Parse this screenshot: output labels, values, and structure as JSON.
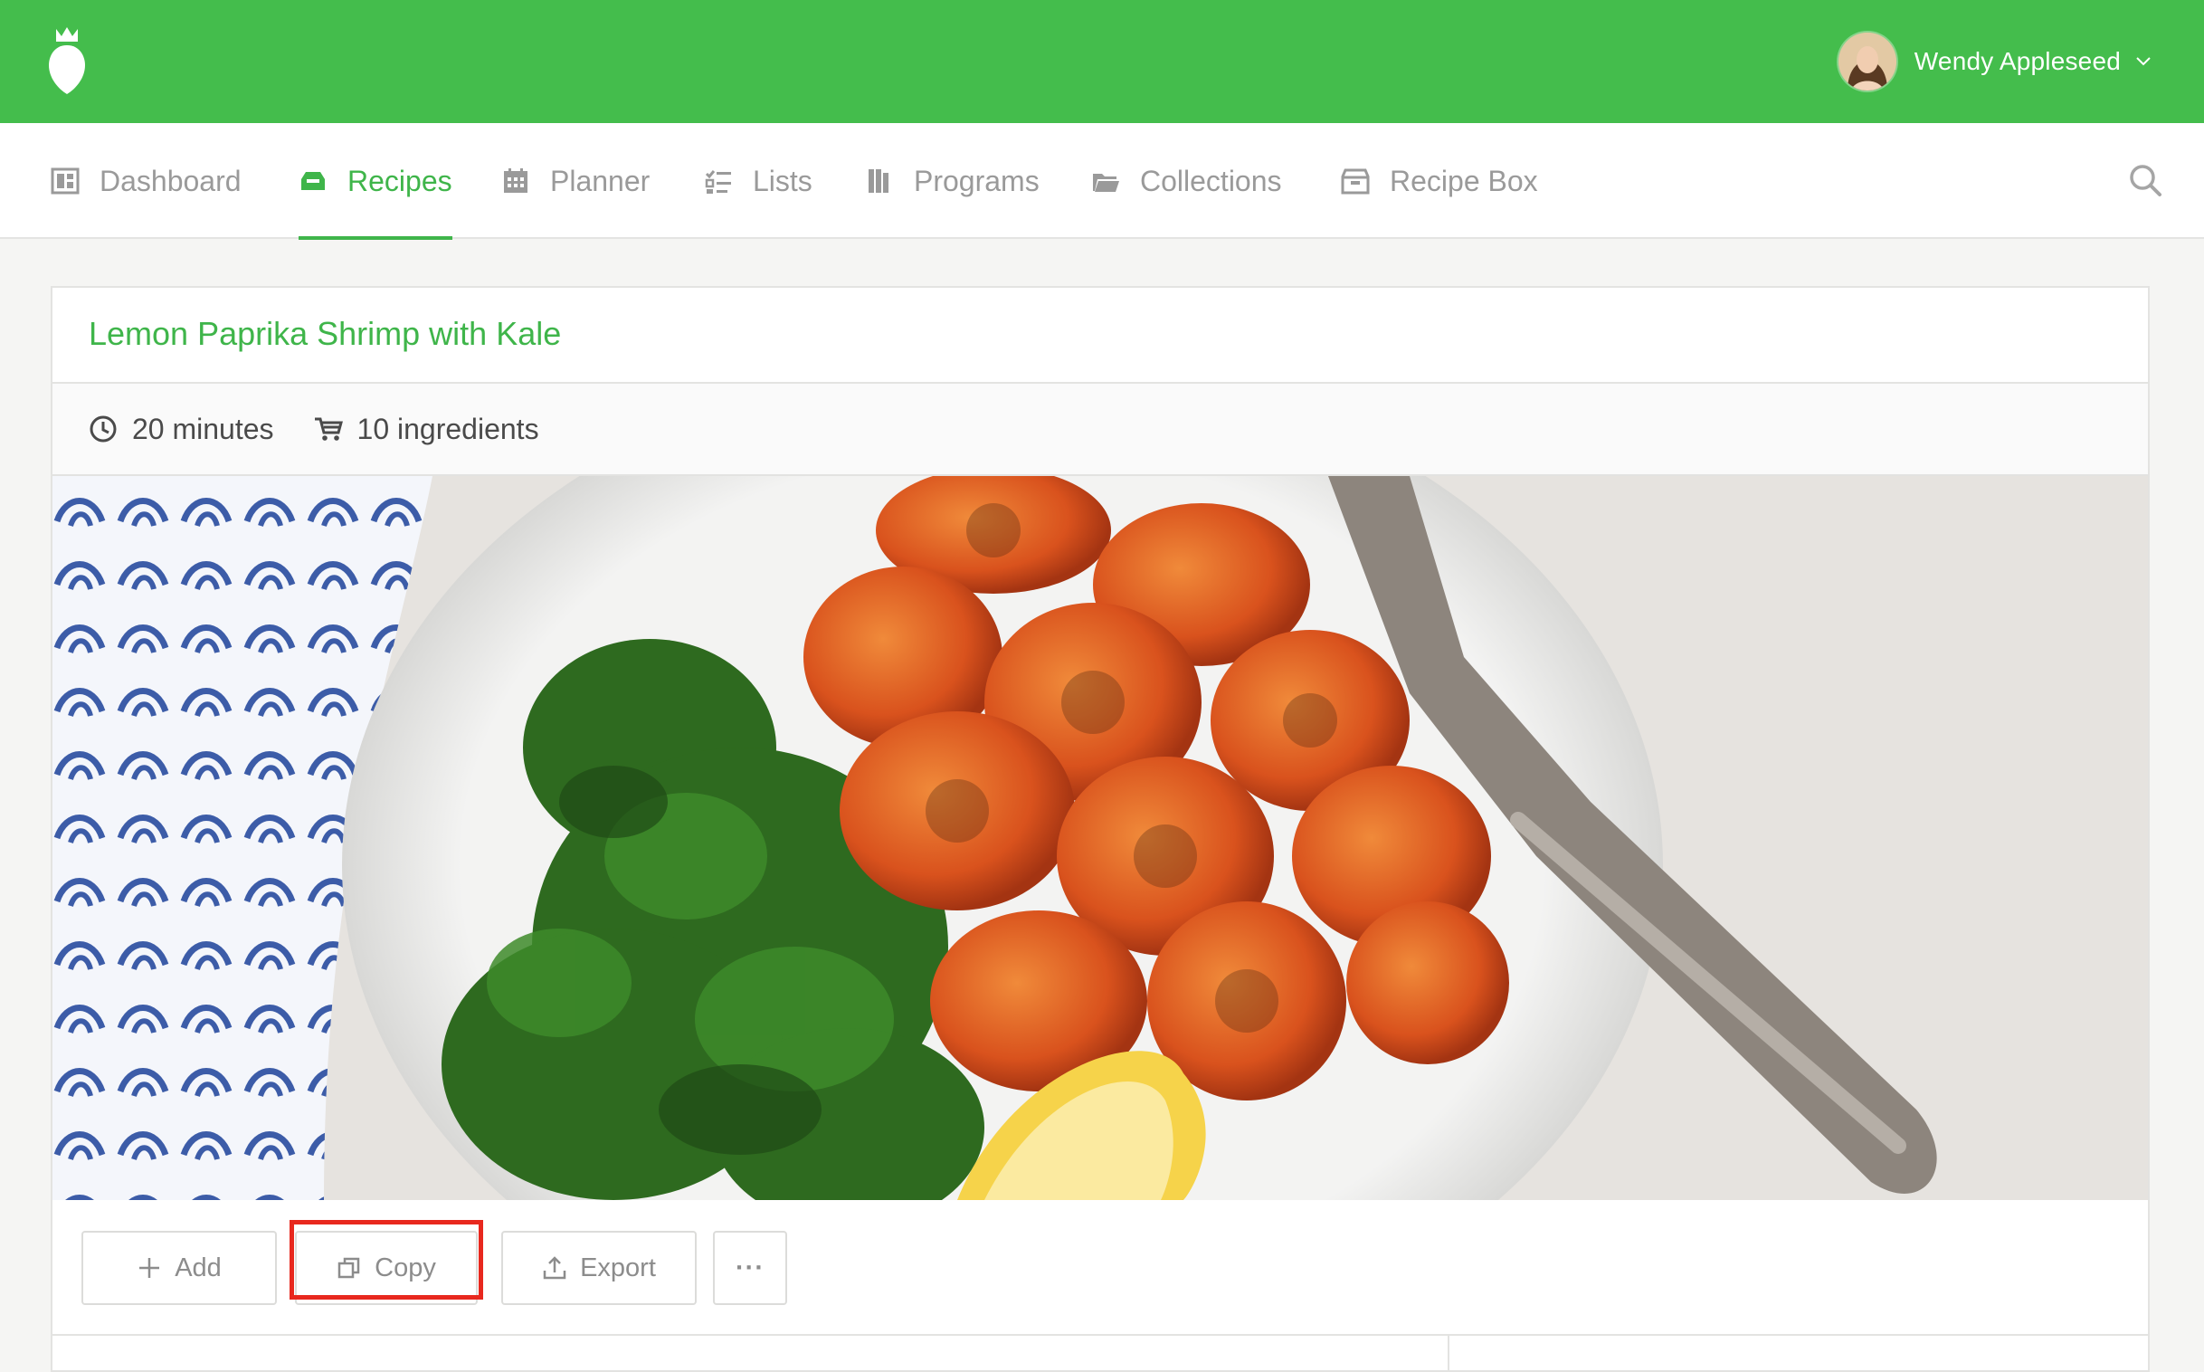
{
  "brand": {
    "accent": "#44bd4c",
    "highlight": "#e8281e",
    "logo_icon": "turnip-logo-icon"
  },
  "user": {
    "name": "Wendy Appleseed",
    "menu_icon": "chevron-down-icon"
  },
  "nav": {
    "items": [
      {
        "label": "Dashboard",
        "icon": "dashboard-icon",
        "active": false
      },
      {
        "label": "Recipes",
        "icon": "recipes-icon",
        "active": true
      },
      {
        "label": "Planner",
        "icon": "calendar-icon",
        "active": false
      },
      {
        "label": "Lists",
        "icon": "checklist-icon",
        "active": false
      },
      {
        "label": "Programs",
        "icon": "book-icon",
        "active": false
      },
      {
        "label": "Collections",
        "icon": "folder-icon",
        "active": false
      },
      {
        "label": "Recipe Box",
        "icon": "box-icon",
        "active": false
      }
    ],
    "search_icon": "search-icon"
  },
  "recipe": {
    "title": "Lemon Paprika Shrimp with Kale",
    "time": "20 minutes",
    "ingredients": "10 ingredients",
    "image_description_icon": "recipe-photo"
  },
  "actions": {
    "add_label": "Add",
    "copy_label": "Copy",
    "export_label": "Export",
    "more_label": "···"
  }
}
